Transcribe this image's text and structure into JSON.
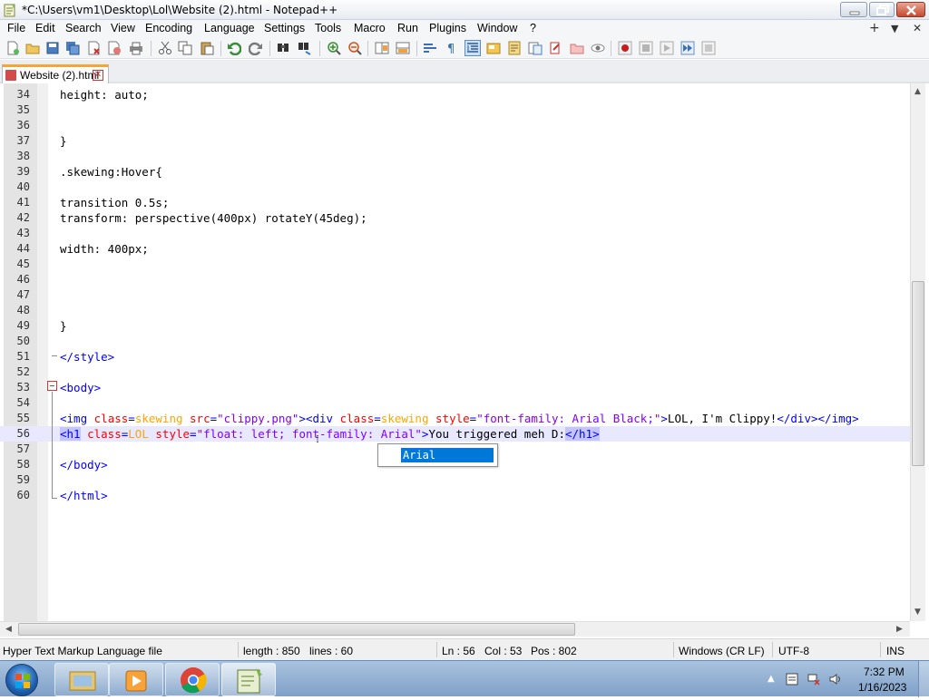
{
  "window": {
    "title": "*C:\\Users\\vm1\\Desktop\\Lol\\Website (2).html - Notepad++"
  },
  "menu": [
    "File",
    "Edit",
    "Search",
    "View",
    "Encoding",
    "Language",
    "Settings",
    "Tools",
    "Macro",
    "Run",
    "Plugins",
    "Window",
    "?"
  ],
  "menu_right": {
    "add": "+",
    "dropdown": "▼",
    "close": "✕"
  },
  "toolbar_icons": [
    "new-file-icon",
    "open-file-icon",
    "save-icon",
    "save-all-icon",
    "close-icon",
    "close-all-icon",
    "print-icon",
    "cut-icon",
    "copy-icon",
    "paste-icon",
    "undo-icon",
    "redo-icon",
    "find-icon",
    "replace-icon",
    "zoom-in-icon",
    "zoom-out-icon",
    "sync-vertical-icon",
    "sync-horizontal-icon",
    "word-wrap-icon",
    "show-all-characters-icon",
    "indent-guide-icon",
    "user-defined-language-icon",
    "document-map-icon",
    "function-list-icon",
    "folder-workspace-icon",
    "monitoring-icon",
    "record-macro-icon",
    "stop-macro-icon",
    "play-macro-icon",
    "run-macro-multiple-icon",
    "save-macro-icon"
  ],
  "tab": {
    "label": "Website (2).html",
    "close": "✕"
  },
  "editor": {
    "lines": [
      {
        "n": "34",
        "text": "height: auto;"
      },
      {
        "n": "35",
        "text": ""
      },
      {
        "n": "36",
        "text": ""
      },
      {
        "n": "37",
        "text": "}"
      },
      {
        "n": "38",
        "text": ""
      },
      {
        "n": "39",
        "text": ".skewing:Hover{"
      },
      {
        "n": "40",
        "text": ""
      },
      {
        "n": "41",
        "text": "transition 0.5s;"
      },
      {
        "n": "42",
        "text": "transform: perspective(400px) rotateY(45deg);"
      },
      {
        "n": "43",
        "text": ""
      },
      {
        "n": "44",
        "text": "width: 400px;"
      },
      {
        "n": "45",
        "text": ""
      },
      {
        "n": "46",
        "text": ""
      },
      {
        "n": "47",
        "text": ""
      },
      {
        "n": "48",
        "text": ""
      },
      {
        "n": "49",
        "text": "}"
      },
      {
        "n": "50",
        "text": ""
      },
      {
        "n": "51",
        "text": "</style>"
      },
      {
        "n": "52",
        "text": ""
      },
      {
        "n": "53",
        "text": "<body>"
      },
      {
        "n": "54",
        "text": ""
      },
      {
        "n": "55",
        "text": "<img class=skewing src=\"clippy.png\"><div class=skewing style=\"font-family: Arial Black;\">LOL, I'm Clippy!</div></img>"
      },
      {
        "n": "56",
        "text": "<h1 class=LOL style=\"float: left; font-family: Arial\">You triggered meh D:</h1>"
      },
      {
        "n": "57",
        "text": ""
      },
      {
        "n": "58",
        "text": "</body>"
      },
      {
        "n": "59",
        "text": ""
      },
      {
        "n": "60",
        "text": "</html>"
      }
    ],
    "autocomplete": [
      "Arial"
    ]
  },
  "status": {
    "language": "Hyper Text Markup Language file",
    "length": "length : 850",
    "lines": "lines : 60",
    "ln": "Ln : 56",
    "col": "Col : 53",
    "pos": "Pos : 802",
    "eol": "Windows (CR LF)",
    "encoding": "UTF-8",
    "mode": "INS"
  },
  "taskbar": {
    "apps": [
      "file-explorer-icon",
      "media-player-icon",
      "chrome-icon",
      "notepad-plus-plus-icon"
    ],
    "time": "7:32 PM",
    "date": "1/16/2023"
  },
  "colors": {
    "tag": "#0000ff",
    "attr": "#ff0000",
    "value": "#8000ff",
    "caret_line": "#e8e8ff",
    "selection": "#0078d7"
  }
}
